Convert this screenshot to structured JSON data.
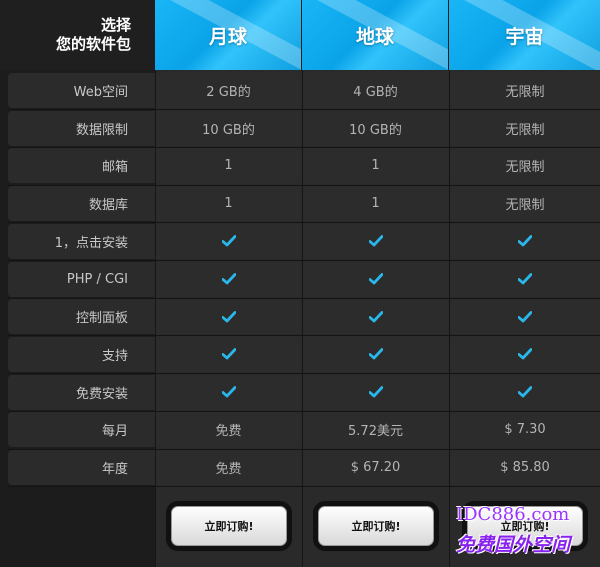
{
  "header": {
    "corner_line1": "选择",
    "corner_line2": "您的软件包",
    "plans": [
      "月球",
      "地球",
      "宇宙"
    ]
  },
  "rows": [
    {
      "label": "Web空间",
      "values": [
        "2 GB的",
        "4 GB的",
        "无限制"
      ]
    },
    {
      "label": "数据限制",
      "values": [
        "10 GB的",
        "10 GB的",
        "无限制"
      ]
    },
    {
      "label": "邮箱",
      "values": [
        "1",
        "1",
        "无限制"
      ]
    },
    {
      "label": "数据库",
      "values": [
        "1",
        "1",
        "无限制"
      ]
    },
    {
      "label": "1，点击安装",
      "values": [
        "check",
        "check",
        "check"
      ]
    },
    {
      "label": "PHP / CGI",
      "values": [
        "check",
        "check",
        "check"
      ]
    },
    {
      "label": "控制面板",
      "values": [
        "check",
        "check",
        "check"
      ]
    },
    {
      "label": "支持",
      "values": [
        "check",
        "check",
        "check"
      ]
    },
    {
      "label": "免费安装",
      "values": [
        "check",
        "check",
        "check"
      ]
    },
    {
      "label": "每月",
      "values": [
        "免费",
        "5.72美元",
        "$ 7.30"
      ]
    },
    {
      "label": "年度",
      "values": [
        "免费",
        "$ 67.20",
        "$ 85.80"
      ]
    }
  ],
  "buttons": [
    "立即订购!",
    "立即订购!",
    "立即订购!"
  ],
  "watermark": {
    "line1": "IDC886.com",
    "line2": "免费国外空间"
  },
  "colors": {
    "header_blue": "#19b6f6",
    "check": "#2ab8ec"
  }
}
